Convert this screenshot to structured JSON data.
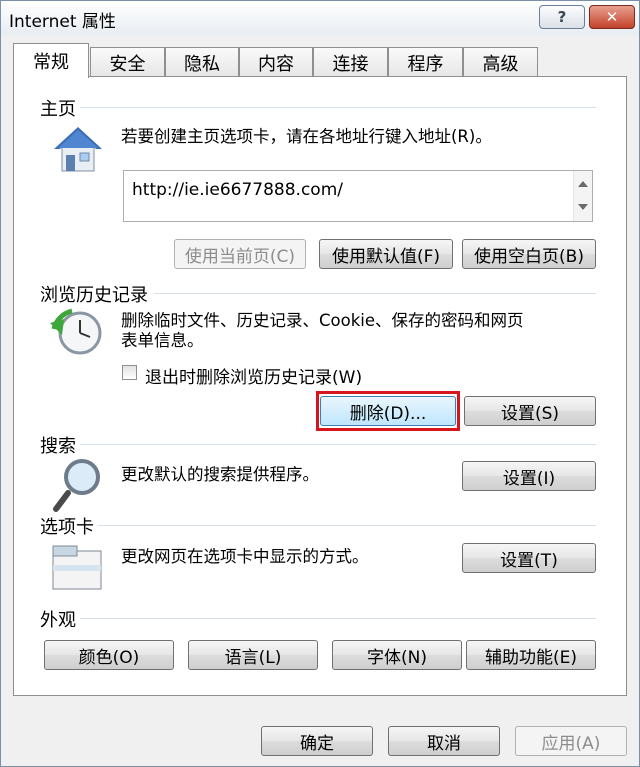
{
  "window": {
    "title": "Internet 属性",
    "help_label": "?",
    "close_label": "✕"
  },
  "tabs": [
    {
      "label": "常规",
      "active": true
    },
    {
      "label": "安全"
    },
    {
      "label": "隐私"
    },
    {
      "label": "内容"
    },
    {
      "label": "连接"
    },
    {
      "label": "程序"
    },
    {
      "label": "高级"
    }
  ],
  "home": {
    "title": "主页",
    "description": "若要创建主页选项卡，请在各地址行键入地址(R)。",
    "url": "http://ie.ie6677888.com/",
    "use_current_label": "使用当前页(C)",
    "use_default_label": "使用默认值(F)",
    "use_blank_label": "使用空白页(B)"
  },
  "history": {
    "title": "浏览历史记录",
    "description_line1": "删除临时文件、历史记录、Cookie、保存的密码和网页",
    "description_line2": "表单信息。",
    "checkbox_label": "退出时删除浏览历史记录(W)",
    "delete_label": "删除(D)...",
    "settings_label": "设置(S)"
  },
  "search": {
    "title": "搜索",
    "description": "更改默认的搜索提供程序。",
    "settings_label": "设置(I)"
  },
  "tabs_section": {
    "title": "选项卡",
    "description": "更改网页在选项卡中显示的方式。",
    "settings_label": "设置(T)"
  },
  "appearance": {
    "title": "外观",
    "colors_label": "颜色(O)",
    "languages_label": "语言(L)",
    "fonts_label": "字体(N)",
    "accessibility_label": "辅助功能(E)"
  },
  "footer": {
    "ok_label": "确定",
    "cancel_label": "取消",
    "apply_label": "应用(A)"
  }
}
